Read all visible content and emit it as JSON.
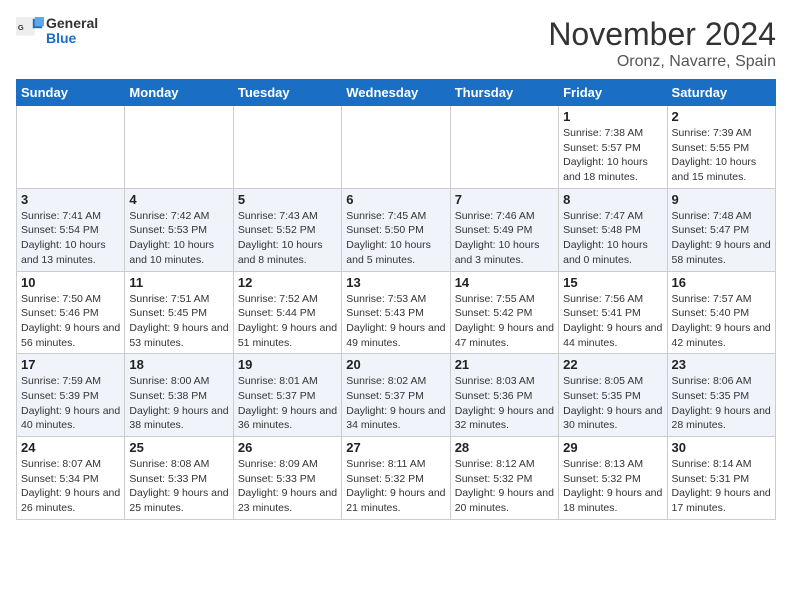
{
  "logo": {
    "text_general": "General",
    "text_blue": "Blue"
  },
  "header": {
    "month": "November 2024",
    "location": "Oronz, Navarre, Spain"
  },
  "weekdays": [
    "Sunday",
    "Monday",
    "Tuesday",
    "Wednesday",
    "Thursday",
    "Friday",
    "Saturday"
  ],
  "weeks": [
    [
      {
        "day": "",
        "info": ""
      },
      {
        "day": "",
        "info": ""
      },
      {
        "day": "",
        "info": ""
      },
      {
        "day": "",
        "info": ""
      },
      {
        "day": "",
        "info": ""
      },
      {
        "day": "1",
        "info": "Sunrise: 7:38 AM\nSunset: 5:57 PM\nDaylight: 10 hours and 18 minutes."
      },
      {
        "day": "2",
        "info": "Sunrise: 7:39 AM\nSunset: 5:55 PM\nDaylight: 10 hours and 15 minutes."
      }
    ],
    [
      {
        "day": "3",
        "info": "Sunrise: 7:41 AM\nSunset: 5:54 PM\nDaylight: 10 hours and 13 minutes."
      },
      {
        "day": "4",
        "info": "Sunrise: 7:42 AM\nSunset: 5:53 PM\nDaylight: 10 hours and 10 minutes."
      },
      {
        "day": "5",
        "info": "Sunrise: 7:43 AM\nSunset: 5:52 PM\nDaylight: 10 hours and 8 minutes."
      },
      {
        "day": "6",
        "info": "Sunrise: 7:45 AM\nSunset: 5:50 PM\nDaylight: 10 hours and 5 minutes."
      },
      {
        "day": "7",
        "info": "Sunrise: 7:46 AM\nSunset: 5:49 PM\nDaylight: 10 hours and 3 minutes."
      },
      {
        "day": "8",
        "info": "Sunrise: 7:47 AM\nSunset: 5:48 PM\nDaylight: 10 hours and 0 minutes."
      },
      {
        "day": "9",
        "info": "Sunrise: 7:48 AM\nSunset: 5:47 PM\nDaylight: 9 hours and 58 minutes."
      }
    ],
    [
      {
        "day": "10",
        "info": "Sunrise: 7:50 AM\nSunset: 5:46 PM\nDaylight: 9 hours and 56 minutes."
      },
      {
        "day": "11",
        "info": "Sunrise: 7:51 AM\nSunset: 5:45 PM\nDaylight: 9 hours and 53 minutes."
      },
      {
        "day": "12",
        "info": "Sunrise: 7:52 AM\nSunset: 5:44 PM\nDaylight: 9 hours and 51 minutes."
      },
      {
        "day": "13",
        "info": "Sunrise: 7:53 AM\nSunset: 5:43 PM\nDaylight: 9 hours and 49 minutes."
      },
      {
        "day": "14",
        "info": "Sunrise: 7:55 AM\nSunset: 5:42 PM\nDaylight: 9 hours and 47 minutes."
      },
      {
        "day": "15",
        "info": "Sunrise: 7:56 AM\nSunset: 5:41 PM\nDaylight: 9 hours and 44 minutes."
      },
      {
        "day": "16",
        "info": "Sunrise: 7:57 AM\nSunset: 5:40 PM\nDaylight: 9 hours and 42 minutes."
      }
    ],
    [
      {
        "day": "17",
        "info": "Sunrise: 7:59 AM\nSunset: 5:39 PM\nDaylight: 9 hours and 40 minutes."
      },
      {
        "day": "18",
        "info": "Sunrise: 8:00 AM\nSunset: 5:38 PM\nDaylight: 9 hours and 38 minutes."
      },
      {
        "day": "19",
        "info": "Sunrise: 8:01 AM\nSunset: 5:37 PM\nDaylight: 9 hours and 36 minutes."
      },
      {
        "day": "20",
        "info": "Sunrise: 8:02 AM\nSunset: 5:37 PM\nDaylight: 9 hours and 34 minutes."
      },
      {
        "day": "21",
        "info": "Sunrise: 8:03 AM\nSunset: 5:36 PM\nDaylight: 9 hours and 32 minutes."
      },
      {
        "day": "22",
        "info": "Sunrise: 8:05 AM\nSunset: 5:35 PM\nDaylight: 9 hours and 30 minutes."
      },
      {
        "day": "23",
        "info": "Sunrise: 8:06 AM\nSunset: 5:35 PM\nDaylight: 9 hours and 28 minutes."
      }
    ],
    [
      {
        "day": "24",
        "info": "Sunrise: 8:07 AM\nSunset: 5:34 PM\nDaylight: 9 hours and 26 minutes."
      },
      {
        "day": "25",
        "info": "Sunrise: 8:08 AM\nSunset: 5:33 PM\nDaylight: 9 hours and 25 minutes."
      },
      {
        "day": "26",
        "info": "Sunrise: 8:09 AM\nSunset: 5:33 PM\nDaylight: 9 hours and 23 minutes."
      },
      {
        "day": "27",
        "info": "Sunrise: 8:11 AM\nSunset: 5:32 PM\nDaylight: 9 hours and 21 minutes."
      },
      {
        "day": "28",
        "info": "Sunrise: 8:12 AM\nSunset: 5:32 PM\nDaylight: 9 hours and 20 minutes."
      },
      {
        "day": "29",
        "info": "Sunrise: 8:13 AM\nSunset: 5:32 PM\nDaylight: 9 hours and 18 minutes."
      },
      {
        "day": "30",
        "info": "Sunrise: 8:14 AM\nSunset: 5:31 PM\nDaylight: 9 hours and 17 minutes."
      }
    ]
  ]
}
